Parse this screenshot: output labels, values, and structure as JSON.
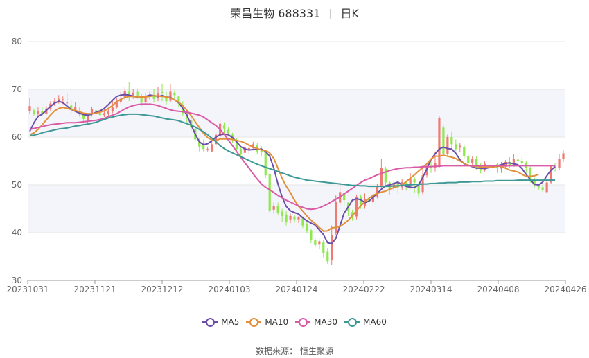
{
  "header": {
    "name": "荣昌生物 688331",
    "period": "日K"
  },
  "source": "数据来源： 恒生聚源",
  "chart_data": {
    "type": "candlestick",
    "y_ticks": [
      30,
      40,
      50,
      60,
      70,
      80
    ],
    "ylim": [
      30,
      80
    ],
    "x_ticks": [
      "20231031",
      "20231121",
      "20231212",
      "20240103",
      "20240124",
      "20240222",
      "20240314",
      "20240408",
      "20240426"
    ],
    "grid": true,
    "legend_position": "bottom",
    "colors": {
      "up": "#f07a72",
      "down": "#8ee84e",
      "MA5": "#6a4eaa",
      "MA10": "#e38f3a",
      "MA30": "#d95aa6",
      "MA60": "#3e9896",
      "grid": "#e6e6e6",
      "band": "#f4f5fb"
    },
    "candles": [
      [
        65.5,
        66.5,
        64.8,
        68.2
      ],
      [
        65.6,
        64.8,
        64.5,
        66.0
      ],
      [
        64.8,
        65.5,
        64.3,
        66.2
      ],
      [
        65.4,
        64.9,
        64.5,
        66.3
      ],
      [
        64.9,
        66.0,
        64.7,
        66.5
      ],
      [
        66.0,
        67.0,
        65.4,
        67.5
      ],
      [
        67.1,
        67.5,
        66.5,
        68.2
      ],
      [
        67.4,
        68.0,
        67.0,
        68.8
      ],
      [
        67.7,
        67.9,
        66.9,
        68.5
      ],
      [
        67.2,
        67.2,
        66.0,
        69.2
      ],
      [
        66.6,
        65.8,
        65.0,
        67.6
      ],
      [
        65.6,
        66.3,
        65.2,
        67.3
      ],
      [
        65.2,
        64.9,
        64.3,
        66.2
      ],
      [
        64.9,
        63.8,
        63.3,
        65.0
      ],
      [
        63.5,
        64.5,
        62.8,
        64.9
      ],
      [
        64.8,
        65.9,
        64.3,
        66.4
      ],
      [
        65.6,
        65.4,
        64.6,
        66.2
      ],
      [
        65.0,
        64.6,
        64.3,
        65.6
      ],
      [
        64.6,
        65.0,
        64.2,
        66.2
      ],
      [
        64.9,
        65.4,
        64.3,
        66.1
      ],
      [
        65.5,
        66.2,
        65.0,
        67.7
      ],
      [
        66.2,
        67.5,
        66.0,
        68.2
      ],
      [
        67.4,
        68.0,
        66.9,
        69.5
      ],
      [
        68.4,
        69.6,
        67.7,
        70.5
      ],
      [
        69.5,
        68.8,
        67.5,
        71.5
      ],
      [
        68.8,
        69.3,
        68.0,
        70.0
      ],
      [
        69.5,
        68.6,
        68.0,
        70.2
      ],
      [
        68.5,
        67.2,
        66.5,
        69.0
      ],
      [
        67.3,
        68.2,
        66.7,
        69.1
      ],
      [
        68.5,
        68.8,
        67.8,
        69.5
      ],
      [
        68.8,
        68.0,
        67.2,
        70.0
      ],
      [
        68.1,
        69.1,
        67.5,
        70.5
      ],
      [
        69.4,
        69.3,
        67.5,
        71.2
      ],
      [
        68.6,
        67.5,
        66.7,
        69.5
      ],
      [
        67.6,
        69.5,
        67.2,
        71.0
      ],
      [
        69.2,
        68.8,
        67.8,
        69.8
      ],
      [
        68.5,
        67.0,
        66.2,
        68.6
      ],
      [
        66.5,
        65.0,
        64.5,
        67.5
      ],
      [
        65.2,
        63.8,
        63.0,
        65.6
      ],
      [
        63.5,
        62.0,
        61.3,
        64.0
      ],
      [
        61.6,
        59.5,
        59.0,
        62.2
      ],
      [
        59.3,
        58.0,
        57.0,
        59.8
      ],
      [
        58.5,
        57.5,
        57.0,
        59.5
      ],
      [
        57.5,
        57.5,
        57.0,
        58.0
      ],
      [
        57.0,
        58.5,
        56.8,
        59.5
      ],
      [
        58.5,
        60.5,
        58.0,
        61.0
      ],
      [
        60.3,
        62.8,
        60.0,
        63.8
      ],
      [
        62.4,
        61.8,
        60.8,
        63.1
      ],
      [
        61.5,
        60.8,
        60.2,
        62.0
      ],
      [
        60.5,
        59.4,
        58.8,
        60.9
      ],
      [
        59.3,
        57.5,
        57.0,
        59.8
      ],
      [
        57.5,
        56.5,
        55.8,
        58.0
      ],
      [
        56.7,
        57.8,
        56.3,
        59.0
      ],
      [
        57.5,
        57.7,
        56.5,
        58.7
      ],
      [
        57.7,
        58.5,
        57.2,
        59.0
      ],
      [
        58.3,
        57.0,
        56.5,
        58.7
      ],
      [
        57.2,
        56.8,
        56.0,
        58.1
      ],
      [
        56.9,
        52.0,
        51.5,
        57.0
      ],
      [
        52.2,
        44.5,
        44.0,
        52.5
      ],
      [
        44.8,
        45.5,
        44.0,
        46.3
      ],
      [
        45.6,
        44.2,
        43.8,
        46.3
      ],
      [
        44.4,
        43.5,
        42.2,
        45.0
      ],
      [
        43.8,
        42.3,
        41.5,
        44.5
      ],
      [
        42.8,
        43.5,
        42.0,
        44.0
      ],
      [
        43.4,
        42.8,
        42.1,
        43.7
      ],
      [
        42.8,
        43.2,
        42.0,
        43.5
      ],
      [
        43.0,
        41.5,
        41.0,
        43.4
      ],
      [
        41.8,
        40.3,
        40.0,
        42.2
      ],
      [
        40.5,
        38.5,
        37.8,
        40.8
      ],
      [
        38.4,
        37.4,
        37.0,
        38.8
      ],
      [
        37.5,
        38.2,
        36.5,
        38.6
      ],
      [
        38.0,
        35.8,
        34.8,
        38.5
      ],
      [
        36.0,
        34.0,
        33.5,
        36.8
      ],
      [
        34.3,
        39.5,
        33.2,
        41.5
      ],
      [
        40.0,
        46.5,
        39.5,
        47.8
      ],
      [
        46.3,
        48.5,
        45.8,
        50.6
      ],
      [
        48.3,
        46.8,
        45.5,
        48.5
      ],
      [
        46.3,
        44.5,
        43.5,
        46.5
      ],
      [
        44.3,
        43.0,
        42.5,
        44.8
      ],
      [
        43.4,
        47.5,
        42.8,
        48.0
      ],
      [
        47.5,
        45.5,
        45.0,
        48.0
      ],
      [
        45.6,
        47.0,
        45.0,
        48.2
      ],
      [
        47.0,
        46.5,
        45.8,
        47.8
      ],
      [
        46.5,
        47.6,
        46.0,
        48.5
      ],
      [
        47.6,
        49.6,
        47.2,
        50.2
      ],
      [
        49.8,
        53.5,
        49.3,
        55.5
      ],
      [
        53.4,
        50.5,
        50.0,
        53.8
      ],
      [
        50.5,
        49.4,
        48.0,
        50.8
      ],
      [
        49.4,
        50.4,
        48.7,
        50.7
      ],
      [
        50.4,
        49.5,
        48.2,
        50.6
      ],
      [
        49.5,
        50.6,
        48.9,
        51.2
      ],
      [
        50.6,
        50.2,
        48.8,
        50.9
      ],
      [
        50.2,
        51.3,
        49.2,
        52.5
      ],
      [
        51.3,
        50.5,
        48.3,
        51.6
      ],
      [
        50.0,
        48.2,
        47.3,
        50.5
      ],
      [
        48.5,
        52.0,
        48.0,
        54.2
      ],
      [
        52.0,
        54.0,
        51.5,
        54.5
      ],
      [
        54.0,
        53.5,
        52.5,
        55.0
      ],
      [
        53.5,
        54.5,
        52.8,
        57.0
      ],
      [
        54.0,
        64.0,
        53.5,
        64.5
      ],
      [
        62.0,
        56.5,
        56.0,
        62.5
      ],
      [
        56.5,
        60.0,
        56.0,
        60.5
      ],
      [
        60.0,
        58.5,
        57.5,
        61.2
      ],
      [
        58.5,
        57.5,
        57.0,
        59.5
      ],
      [
        57.8,
        58.2,
        56.8,
        58.8
      ],
      [
        58.0,
        56.0,
        55.5,
        58.5
      ],
      [
        56.0,
        54.5,
        54.0,
        56.5
      ],
      [
        54.5,
        55.5,
        54.0,
        56.0
      ],
      [
        55.5,
        54.0,
        53.2,
        56.0
      ],
      [
        54.2,
        53.0,
        52.4,
        54.5
      ],
      [
        53.2,
        54.4,
        52.8,
        55.0
      ],
      [
        54.2,
        53.5,
        52.8,
        54.8
      ],
      [
        53.7,
        54.2,
        53.4,
        55.2
      ],
      [
        54.3,
        53.5,
        52.5,
        54.5
      ],
      [
        53.4,
        53.9,
        52.5,
        54.8
      ],
      [
        53.8,
        54.8,
        53.3,
        55.2
      ],
      [
        54.8,
        54.2,
        53.5,
        55.8
      ],
      [
        54.2,
        55.4,
        53.8,
        56.5
      ],
      [
        55.3,
        55.0,
        54.3,
        56.2
      ],
      [
        55.0,
        54.5,
        53.8,
        56.1
      ],
      [
        54.5,
        53.5,
        52.5,
        55.0
      ],
      [
        53.5,
        51.0,
        50.5,
        53.8
      ],
      [
        51.0,
        50.0,
        49.5,
        51.5
      ],
      [
        50.0,
        49.5,
        49.0,
        50.3
      ],
      [
        49.5,
        49.0,
        48.5,
        50.0
      ],
      [
        48.5,
        50.5,
        48.2,
        51.0
      ],
      [
        50.5,
        54.0,
        50.2,
        54.2
      ],
      [
        54.0,
        53.6,
        52.8,
        54.5
      ],
      [
        53.5,
        55.5,
        53.0,
        56.5
      ],
      [
        55.4,
        56.6,
        54.8,
        57.2
      ]
    ],
    "series": [
      {
        "name": "MA5",
        "values": [
          61.2,
          63.0,
          64.3,
          64.8,
          65.6,
          66.4,
          67.1,
          67.5,
          67.2,
          66.5,
          65.8,
          65.4,
          65.0,
          64.7,
          64.6,
          64.8,
          65.2,
          65.5,
          66.0,
          66.8,
          67.7,
          68.5,
          68.8,
          68.9,
          68.8,
          68.6,
          68.3,
          68.3,
          68.5,
          68.8,
          68.7,
          68.5,
          68.7,
          68.4,
          68.3,
          67.8,
          67.2,
          66.0,
          64.6,
          62.6,
          60.6,
          59.0,
          58.4,
          58.6,
          59.2,
          60.0,
          60.5,
          60.6,
          60.5,
          59.9,
          59.0,
          58.0,
          57.5,
          57.3,
          57.4,
          57.4,
          57.5,
          57.0,
          56.0,
          53.5,
          50.2,
          47.5,
          45.5,
          44.6,
          44.2,
          43.9,
          43.1,
          42.5,
          42.0,
          41.6,
          40.6,
          39.6,
          37.9,
          37.7,
          38.8,
          41.5,
          44.1,
          45.4,
          46.8,
          47.1,
          46.9,
          46.3,
          46.6,
          47.4,
          48.2,
          49.1,
          49.8,
          50.0,
          50.3,
          50.6,
          50.0,
          49.7,
          49.5,
          49.4,
          50.0,
          51.6,
          53.3,
          55.3,
          56.5,
          57.5,
          57.9,
          57.6,
          57.5,
          56.6,
          55.3,
          54.4,
          54.1,
          53.8,
          53.5,
          53.5,
          53.4,
          53.6,
          53.8,
          54.0,
          54.2,
          54.5,
          54.6,
          54.4,
          54.2,
          53.4,
          52.2,
          51.1,
          50.1,
          50.0,
          50.6,
          51.9,
          53.1,
          53.8
        ]
      },
      {
        "name": "MA10",
        "values": [
          60.5,
          60.9,
          61.6,
          62.6,
          63.6,
          64.6,
          65.5,
          66.0,
          66.2,
          66.0,
          65.8,
          65.6,
          65.3,
          65.0,
          64.9,
          64.9,
          65.0,
          65.2,
          65.5,
          66.0,
          66.6,
          67.4,
          67.9,
          68.3,
          68.5,
          68.5,
          68.4,
          68.4,
          68.4,
          68.5,
          68.7,
          68.6,
          68.5,
          68.4,
          68.2,
          67.8,
          67.3,
          66.6,
          65.6,
          64.5,
          63.2,
          62.0,
          60.8,
          59.9,
          59.4,
          59.3,
          59.6,
          59.6,
          59.6,
          59.5,
          59.3,
          59.1,
          58.8,
          58.3,
          57.9,
          57.6,
          57.3,
          57.2,
          56.7,
          55.5,
          53.5,
          51.4,
          49.7,
          48.4,
          46.8,
          45.5,
          44.5,
          43.5,
          42.6,
          41.9,
          41.1,
          40.3,
          40.4,
          41.0,
          41.1,
          41.3,
          41.9,
          42.6,
          43.6,
          44.6,
          45.6,
          46.5,
          47.2,
          47.8,
          48.2,
          48.5,
          48.7,
          49.1,
          49.4,
          49.7,
          50.0,
          50.7,
          51.4,
          52.1,
          52.9,
          53.6,
          54.4,
          55.4,
          56.0,
          56.0,
          56.2,
          56.0,
          55.8,
          55.5,
          55.0,
          54.5,
          54.1,
          53.9,
          53.9,
          53.7,
          53.7,
          53.7,
          53.7,
          53.9,
          53.9,
          53.5,
          53.1,
          52.9,
          52.7,
          52.2,
          51.8,
          51.8,
          51.9,
          52.2
        ]
      },
      {
        "name": "MA30",
        "values": [
          61.6,
          61.8,
          62.0,
          62.2,
          62.4,
          62.6,
          62.7,
          62.8,
          62.9,
          63.0,
          63.0,
          63.0,
          63.1,
          63.2,
          63.3,
          63.4,
          63.5,
          63.7,
          63.9,
          64.3,
          64.6,
          64.9,
          65.4,
          65.9,
          66.3,
          66.6,
          66.8,
          66.9,
          66.9,
          66.9,
          66.8,
          66.6,
          66.3,
          66.0,
          65.7,
          65.5,
          65.4,
          65.3,
          65.2,
          65.0,
          64.8,
          64.6,
          64.2,
          63.6,
          63.0,
          62.4,
          61.6,
          60.6,
          59.4,
          58.2,
          57.0,
          55.8,
          54.6,
          53.5,
          52.3,
          51.2,
          50.2,
          49.5,
          49.0,
          48.4,
          47.8,
          47.3,
          46.8,
          46.4,
          46.0,
          45.6,
          45.3,
          45.0,
          44.9,
          45.0,
          45.2,
          45.6,
          46.0,
          46.5,
          47.0,
          47.5,
          48.1,
          48.7,
          49.3,
          49.9,
          50.5,
          51.0,
          51.3,
          51.7,
          52.1,
          52.4,
          52.7,
          53.0,
          53.2,
          53.4,
          53.5,
          53.6,
          53.6,
          53.7,
          53.7,
          53.8,
          53.8,
          53.8,
          53.9,
          53.9,
          54.0,
          54.0,
          54.0,
          54.0,
          54.0,
          54.0,
          54.0,
          54.0,
          54.0,
          54.0,
          54.0,
          54.0,
          54.0,
          54.0,
          54.0,
          54.0,
          54.0,
          54.0,
          54.0,
          54.0,
          54.0,
          54.0,
          54.0,
          54.0,
          54.0,
          54.0,
          54.0,
          54.0
        ]
      },
      {
        "name": "MA60",
        "values": [
          60.3,
          60.4,
          60.6,
          60.9,
          61.1,
          61.3,
          61.5,
          61.7,
          61.8,
          61.9,
          62.1,
          62.3,
          62.4,
          62.6,
          62.7,
          62.9,
          63.1,
          63.4,
          63.7,
          64.0,
          64.2,
          64.4,
          64.6,
          64.7,
          64.8,
          64.8,
          64.8,
          64.7,
          64.6,
          64.5,
          64.4,
          64.2,
          64.0,
          63.8,
          63.7,
          63.6,
          63.4,
          63.1,
          62.8,
          62.5,
          62.1,
          61.6,
          61.1,
          60.5,
          59.8,
          59.0,
          58.2,
          57.6,
          57.1,
          56.7,
          56.3,
          55.9,
          55.5,
          55.1,
          54.7,
          54.3,
          54.0,
          53.7,
          53.4,
          53.1,
          52.8,
          52.5,
          52.2,
          51.9,
          51.6,
          51.4,
          51.2,
          51.0,
          50.9,
          50.8,
          50.7,
          50.6,
          50.5,
          50.4,
          50.3,
          50.2,
          50.1,
          50.0,
          49.9,
          49.9,
          49.8,
          49.8,
          49.7,
          49.7,
          49.7,
          49.7,
          49.7,
          49.7,
          49.8,
          49.8,
          49.9,
          50.0,
          50.0,
          50.1,
          50.1,
          50.2,
          50.2,
          50.3,
          50.3,
          50.4,
          50.4,
          50.5,
          50.5,
          50.5,
          50.6,
          50.6,
          50.6,
          50.7,
          50.7,
          50.7,
          50.8,
          50.8,
          50.8,
          50.9,
          50.9,
          50.9,
          50.9,
          50.9,
          51.0,
          51.0,
          51.0,
          51.0,
          51.0,
          51.0,
          51.0,
          51.0,
          51.0,
          51.0
        ]
      }
    ]
  }
}
